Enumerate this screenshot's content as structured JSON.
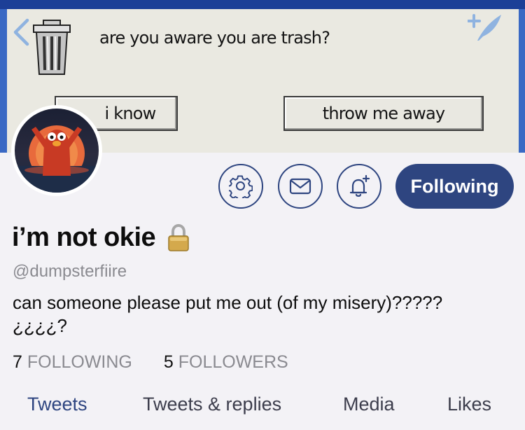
{
  "banner": {
    "dialog_text": "are you aware you are trash?",
    "button_know": "i know",
    "button_throw": "throw me away"
  },
  "actions": {
    "following_label": "Following"
  },
  "profile": {
    "display_name": "i’m not okie",
    "handle": "@dumpsterfiire",
    "bio_line1": "can someone please put me out (of my misery)?????",
    "bio_line2": "¿¿¿¿?",
    "following_count": "7",
    "following_label": "FOLLOWING",
    "followers_count": "5",
    "followers_label": "FOLLOWERS"
  },
  "tabs": [
    {
      "label": "Tweets",
      "active": true
    },
    {
      "label": "Tweets & replies",
      "active": false
    },
    {
      "label": "Media",
      "active": false
    },
    {
      "label": "Likes",
      "active": false
    }
  ],
  "colors": {
    "accent": "#2e4580",
    "background": "#f3f2f6",
    "muted_text": "#8a8a90"
  },
  "icons": [
    "back-icon",
    "trash-icon",
    "compose-icon",
    "settings-icon",
    "mail-icon",
    "notification-add-icon",
    "lock-icon"
  ]
}
